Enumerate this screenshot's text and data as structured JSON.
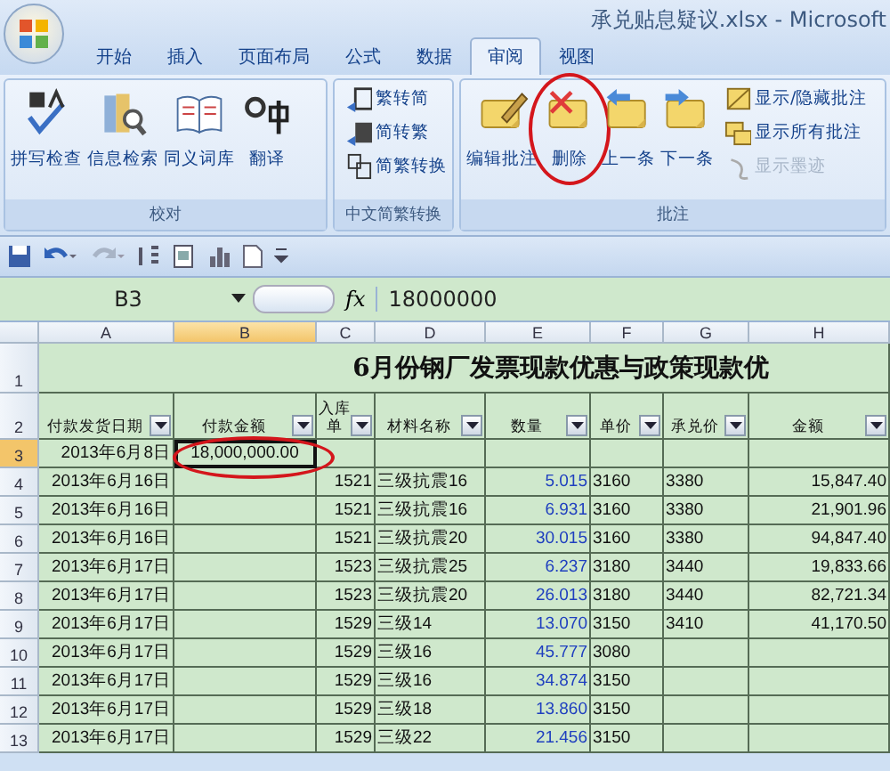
{
  "window": {
    "title": "承兑贴息疑议.xlsx - Microsoft"
  },
  "tabs": [
    {
      "label": "开始",
      "selected": false
    },
    {
      "label": "插入",
      "selected": false
    },
    {
      "label": "页面布局",
      "selected": false
    },
    {
      "label": "公式",
      "selected": false
    },
    {
      "label": "数据",
      "selected": false
    },
    {
      "label": "审阅",
      "selected": true
    },
    {
      "label": "视图",
      "selected": false
    }
  ],
  "ribbon_groups": [
    {
      "label": "校对",
      "buttons": [
        {
          "kind": "large",
          "label": "拼写检查",
          "disabled": false,
          "circled": false
        },
        {
          "kind": "large",
          "label": "信息检索",
          "disabled": false,
          "circled": false
        },
        {
          "kind": "large",
          "label": "同义词库",
          "disabled": false,
          "circled": false
        },
        {
          "kind": "large",
          "label": "翻译",
          "disabled": false,
          "circled": false
        }
      ]
    },
    {
      "label": "中文简繁转换",
      "buttons": [
        {
          "kind": "small",
          "label": "繁转简",
          "disabled": false,
          "circled": false
        },
        {
          "kind": "small",
          "label": "简转繁",
          "disabled": false,
          "circled": false
        },
        {
          "kind": "small",
          "label": "简繁转换",
          "disabled": false,
          "circled": false
        }
      ]
    },
    {
      "label": "批注",
      "buttons": [
        {
          "kind": "large",
          "label": "编辑批注",
          "disabled": false,
          "circled": false
        },
        {
          "kind": "large",
          "label": "删除",
          "disabled": false,
          "circled": true
        },
        {
          "kind": "large",
          "label": "上一条",
          "disabled": false,
          "circled": false
        },
        {
          "kind": "large",
          "label": "下一条",
          "disabled": false,
          "circled": false
        },
        {
          "kind": "small",
          "label": "显示/隐藏批注",
          "disabled": false,
          "circled": false
        },
        {
          "kind": "small",
          "label": "显示所有批注",
          "disabled": false,
          "circled": false
        },
        {
          "kind": "small",
          "label": "显示墨迹",
          "disabled": true,
          "circled": false
        }
      ]
    }
  ],
  "formula_bar": {
    "name_box": "B3",
    "fx": "fx",
    "value": "18000000"
  },
  "sheet": {
    "columns": [
      {
        "label": "A",
        "selected": false
      },
      {
        "label": "B",
        "selected": true
      },
      {
        "label": "C",
        "selected": false
      },
      {
        "label": "D",
        "selected": false
      },
      {
        "label": "E",
        "selected": false
      },
      {
        "label": "F",
        "selected": false
      },
      {
        "label": "G",
        "selected": false
      },
      {
        "label": "H",
        "selected": false
      }
    ],
    "title_row": {
      "number": "1",
      "text": "6月份钢厂发票现款优惠与政策现款优"
    },
    "header_row": {
      "number": "2",
      "headers": [
        {
          "text": "付款发货日期",
          "filter": true
        },
        {
          "text": "付款金额",
          "filter": true
        },
        {
          "text": "入库单",
          "filter": true
        },
        {
          "text": "材料名称",
          "filter": true
        },
        {
          "text": "数量",
          "filter": true
        },
        {
          "text": "单价",
          "filter": true
        },
        {
          "text": "承兑价",
          "filter": true
        },
        {
          "text": "金额",
          "filter": true
        }
      ]
    },
    "rows": [
      {
        "number": "3",
        "selected": true,
        "cells": [
          "2013年6月8日",
          {
            "text": "18,000,000.00",
            "selected": true,
            "circled": true
          },
          null,
          null,
          null,
          null,
          null,
          null
        ]
      },
      {
        "number": "4",
        "selected": false,
        "cells": [
          "2013年6月16日",
          null,
          "1521",
          "三级抗震16",
          "5.015",
          "3160",
          "3380",
          "15,847.40"
        ]
      },
      {
        "number": "5",
        "selected": false,
        "cells": [
          "2013年6月16日",
          null,
          "1521",
          "三级抗震16",
          "6.931",
          "3160",
          "3380",
          "21,901.96"
        ]
      },
      {
        "number": "6",
        "selected": false,
        "cells": [
          "2013年6月16日",
          null,
          "1521",
          "三级抗震20",
          "30.015",
          "3160",
          "3380",
          "94,847.40"
        ]
      },
      {
        "number": "7",
        "selected": false,
        "cells": [
          "2013年6月17日",
          null,
          "1523",
          "三级抗震25",
          "6.237",
          "3180",
          "3440",
          "19,833.66"
        ]
      },
      {
        "number": "8",
        "selected": false,
        "cells": [
          "2013年6月17日",
          null,
          "1523",
          "三级抗震20",
          "26.013",
          "3180",
          "3440",
          "82,721.34"
        ]
      },
      {
        "number": "9",
        "selected": false,
        "cells": [
          "2013年6月17日",
          null,
          "1529",
          "三级14",
          "13.070",
          "3150",
          "3410",
          "41,170.50"
        ]
      },
      {
        "number": "10",
        "selected": false,
        "cells": [
          "2013年6月17日",
          null,
          "1529",
          "三级16",
          "45.777",
          "3080",
          null,
          null
        ]
      },
      {
        "number": "11",
        "selected": false,
        "cells": [
          "2013年6月17日",
          null,
          "1529",
          "三级16",
          "34.874",
          "3150",
          null,
          null
        ]
      },
      {
        "number": "12",
        "selected": false,
        "cells": [
          "2013年6月17日",
          null,
          "1529",
          "三级18",
          "13.860",
          "3150",
          null,
          null
        ]
      },
      {
        "number": "13",
        "selected": false,
        "cells": [
          "2013年6月17日",
          null,
          "1529",
          "三级22",
          "21.456",
          "3150",
          null,
          null
        ]
      }
    ]
  }
}
